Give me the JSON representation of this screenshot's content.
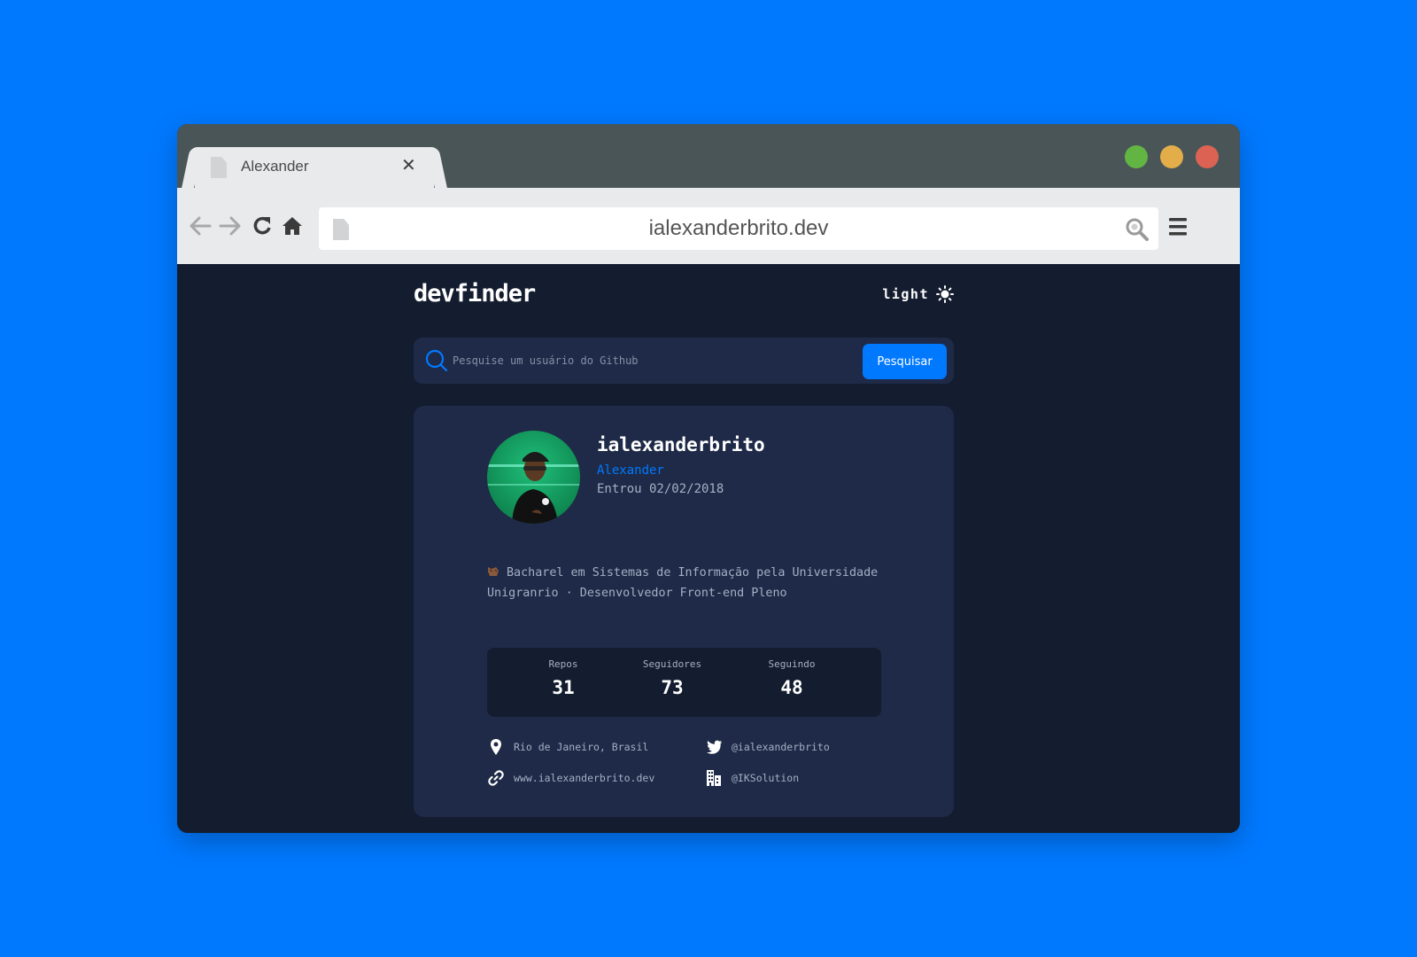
{
  "browser": {
    "tab_title": "Alexander",
    "url": "ialexanderbrito.dev"
  },
  "app": {
    "logo": "devfinder",
    "theme_label": "light",
    "search": {
      "placeholder": "Pesquise um usuário do Github",
      "value": "",
      "button_label": "Pesquisar"
    },
    "profile": {
      "username": "ialexanderbrito",
      "name": "Alexander",
      "joined": "Entrou 02/02/2018",
      "bio": "Bacharel em Sistemas de Informação pela Universidade Unigranrio · Desenvolvedor Front-end Pleno",
      "stats": [
        {
          "label": "Repos",
          "value": "31"
        },
        {
          "label": "Seguidores",
          "value": "73"
        },
        {
          "label": "Seguindo",
          "value": "48"
        }
      ],
      "location": "Rio de Janeiro, Brasil",
      "twitter": "@ialexanderbrito",
      "website": "www.ialexanderbrito.dev",
      "company": "@IKSolution"
    }
  },
  "colors": {
    "background": "#0079ff",
    "page_bg": "#141d2f",
    "card_bg": "#1e2a47",
    "accent": "#0079ff",
    "muted_text": "#a4b0c4",
    "window_green": "#62b543",
    "window_yellow": "#e3ad4a",
    "window_red": "#dc6353"
  },
  "icons": {
    "tab_doc": "document-icon",
    "tab_close": "close-icon",
    "back": "arrow-left-icon",
    "forward": "arrow-right-icon",
    "reload": "reload-icon",
    "home": "home-icon",
    "url_search": "magnifier-icon",
    "menu": "hamburger-menu-icon",
    "theme": "sun-icon",
    "search": "search-icon",
    "bio": "cat-emoji-icon",
    "location": "location-pin-icon",
    "twitter": "twitter-icon",
    "website": "link-icon",
    "company": "building-icon"
  }
}
